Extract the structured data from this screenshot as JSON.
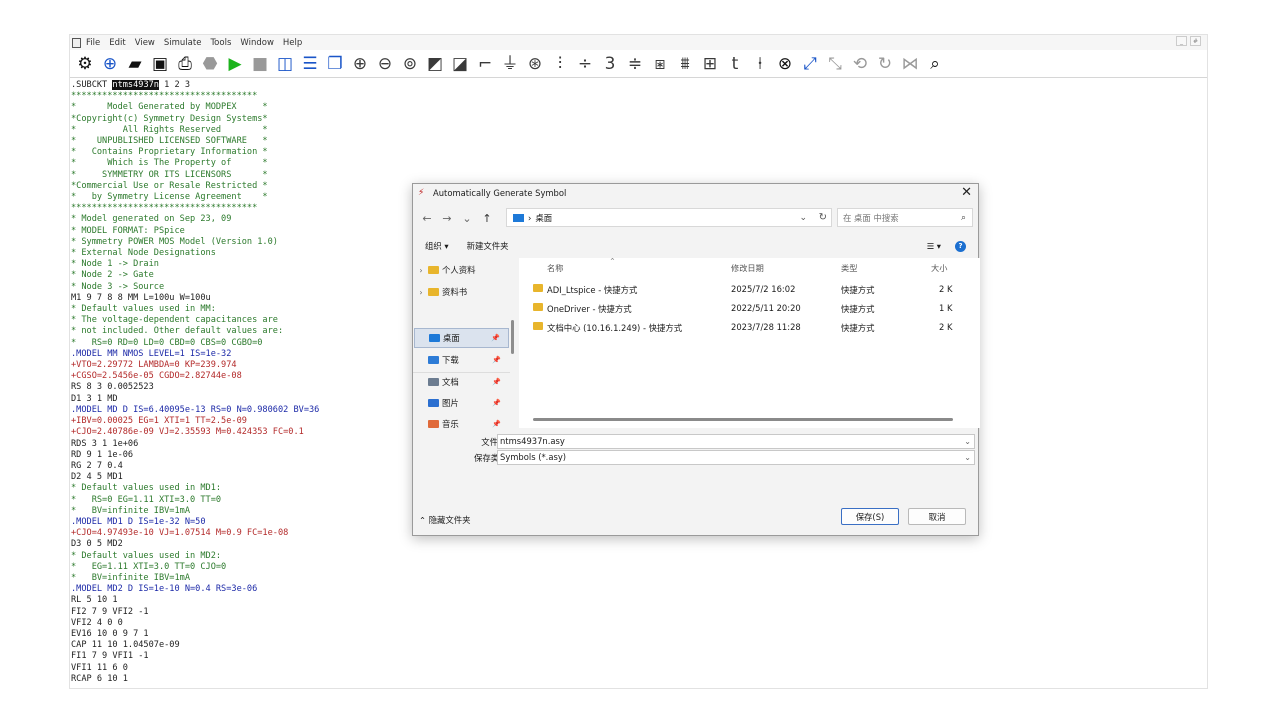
{
  "menubar": {
    "items": [
      "File",
      "Edit",
      "View",
      "Simulate",
      "Tools",
      "Window",
      "Help"
    ],
    "window_controls": [
      "_",
      "#"
    ]
  },
  "toolbar": {
    "icons": [
      "settings-icon",
      "new-schematic-icon",
      "open-icon",
      "save-icon",
      "print-icon",
      "control-panel-icon",
      "run-icon",
      "halt-icon",
      "tile-vertical-icon",
      "tile-horizontal-icon",
      "cascade-icon",
      "zoom-in-icon",
      "zoom-out-icon",
      "zoom-fit-icon",
      "autorange-icon",
      "pan-icon",
      "wire-icon",
      "ground-icon",
      "label-icon",
      "resistor-icon",
      "capacitor-icon",
      "inductor-icon",
      "diode-icon",
      "component-icon",
      "move-icon",
      "drag-icon",
      "text-icon",
      "spice-directive-icon",
      "delete-icon",
      "duplicate-icon",
      "undo-icon",
      "redo-icon",
      "rotate-icon",
      "mirror-icon",
      "find-icon"
    ]
  },
  "netlist": {
    "lines": [
      {
        "text": ".SUBCKT ",
        "color": "black",
        "highlight": "ntms4937n",
        "tail": " 1 2 3"
      },
      {
        "text": "************************************",
        "color": "green"
      },
      {
        "text": "*      Model Generated by MODPEX     *",
        "color": "green"
      },
      {
        "text": "*Copyright(c) Symmetry Design Systems*",
        "color": "green"
      },
      {
        "text": "*         All Rights Reserved        *",
        "color": "green"
      },
      {
        "text": "*    UNPUBLISHED LICENSED SOFTWARE   *",
        "color": "green"
      },
      {
        "text": "*   Contains Proprietary Information *",
        "color": "green"
      },
      {
        "text": "*      Which is The Property of      *",
        "color": "green"
      },
      {
        "text": "*     SYMMETRY OR ITS LICENSORS      *",
        "color": "green"
      },
      {
        "text": "*Commercial Use or Resale Restricted *",
        "color": "green"
      },
      {
        "text": "*   by Symmetry License Agreement    *",
        "color": "green"
      },
      {
        "text": "************************************",
        "color": "green"
      },
      {
        "text": "* Model generated on Sep 23, 09",
        "color": "green"
      },
      {
        "text": "* MODEL FORMAT: PSpice",
        "color": "green"
      },
      {
        "text": "* Symmetry POWER MOS Model (Version 1.0)",
        "color": "green"
      },
      {
        "text": "* External Node Designations",
        "color": "green"
      },
      {
        "text": "* Node 1 -> Drain",
        "color": "green"
      },
      {
        "text": "* Node 2 -> Gate",
        "color": "green"
      },
      {
        "text": "* Node 3 -> Source",
        "color": "green"
      },
      {
        "text": "M1 9 7 8 8 MM L=100u W=100u",
        "color": "black"
      },
      {
        "text": "* Default values used in MM:",
        "color": "green"
      },
      {
        "text": "* The voltage-dependent capacitances are",
        "color": "green"
      },
      {
        "text": "* not included. Other default values are:",
        "color": "green"
      },
      {
        "text": "*   RS=0 RD=0 LD=0 CBD=0 CBS=0 CGBO=0",
        "color": "green"
      },
      {
        "text": ".MODEL MM NMOS LEVEL=1 IS=1e-32",
        "color": "blue"
      },
      {
        "text": "+VTO=2.29772 LAMBDA=0 KP=239.974",
        "color": "red"
      },
      {
        "text": "+CGSO=2.5456e-05 CGDO=2.82744e-08",
        "color": "red"
      },
      {
        "text": "RS 8 3 0.0052523",
        "color": "black"
      },
      {
        "text": "D1 3 1 MD",
        "color": "black"
      },
      {
        "text": ".MODEL MD D IS=6.40095e-13 RS=0 N=0.980602 BV=36",
        "color": "blue"
      },
      {
        "text": "+IBV=0.00025 EG=1 XTI=1 TT=2.5e-09",
        "color": "red"
      },
      {
        "text": "+CJO=2.40786e-09 VJ=2.35593 M=0.424353 FC=0.1",
        "color": "red"
      },
      {
        "text": "RDS 3 1 1e+06",
        "color": "black"
      },
      {
        "text": "RD 9 1 1e-06",
        "color": "black"
      },
      {
        "text": "RG 2 7 0.4",
        "color": "black"
      },
      {
        "text": "D2 4 5 MD1",
        "color": "black"
      },
      {
        "text": "* Default values used in MD1:",
        "color": "green"
      },
      {
        "text": "*   RS=0 EG=1.11 XTI=3.0 TT=0",
        "color": "green"
      },
      {
        "text": "*   BV=infinite IBV=1mA",
        "color": "green"
      },
      {
        "text": ".MODEL MD1 D IS=1e-32 N=50",
        "color": "blue"
      },
      {
        "text": "+CJO=4.97493e-10 VJ=1.07514 M=0.9 FC=1e-08",
        "color": "red"
      },
      {
        "text": "D3 0 5 MD2",
        "color": "black"
      },
      {
        "text": "* Default values used in MD2:",
        "color": "green"
      },
      {
        "text": "*   EG=1.11 XTI=3.0 TT=0 CJO=0",
        "color": "green"
      },
      {
        "text": "*   BV=infinite IBV=1mA",
        "color": "green"
      },
      {
        "text": ".MODEL MD2 D IS=1e-10 N=0.4 RS=3e-06",
        "color": "blue"
      },
      {
        "text": "RL 5 10 1",
        "color": "black"
      },
      {
        "text": "FI2 7 9 VFI2 -1",
        "color": "black"
      },
      {
        "text": "VFI2 4 0 0",
        "color": "black"
      },
      {
        "text": "EV16 10 0 9 7 1",
        "color": "black"
      },
      {
        "text": "CAP 11 10 1.04507e-09",
        "color": "black"
      },
      {
        "text": "FI1 7 9 VFI1 -1",
        "color": "black"
      },
      {
        "text": "VFI1 11 6 0",
        "color": "black"
      },
      {
        "text": "RCAP 6 10 1",
        "color": "black"
      }
    ]
  },
  "dialog": {
    "title": "Automatically Generate Symbol",
    "address": "桌面",
    "search_placeholder": "在 桌面 中搜索",
    "organize": "组织 ▾",
    "new_folder": "新建文件夹",
    "nav_items": [
      {
        "label": "个人资料",
        "type": "folder"
      },
      {
        "label": "资料书",
        "type": "folder"
      },
      {
        "label": "桌面",
        "type": "desktop"
      },
      {
        "label": "下载",
        "type": "download"
      },
      {
        "label": "文档",
        "type": "document"
      },
      {
        "label": "图片",
        "type": "picture"
      },
      {
        "label": "音乐",
        "type": "music"
      }
    ],
    "columns": [
      "名称",
      "修改日期",
      "类型",
      "大小"
    ],
    "files": [
      {
        "name": "ADI_Ltspice - 快捷方式",
        "date": "2025/7/2 16:02",
        "type": "快捷方式",
        "size": "2 K"
      },
      {
        "name": "OneDriver - 快捷方式",
        "date": "2022/5/11 20:20",
        "type": "快捷方式",
        "size": "1 K"
      },
      {
        "name": "文档中心 (10.16.1.249) - 快捷方式",
        "date": "2023/7/28 11:28",
        "type": "快捷方式",
        "size": "2 K"
      }
    ],
    "filename_label": "文件名(N):",
    "filename_value": "ntms4937n.asy",
    "savetype_label": "保存类型(T):",
    "savetype_value": "Symbols (*.asy)",
    "hide_folders": "隐藏文件夹",
    "save_button": "保存(S)",
    "cancel_button": "取消"
  }
}
